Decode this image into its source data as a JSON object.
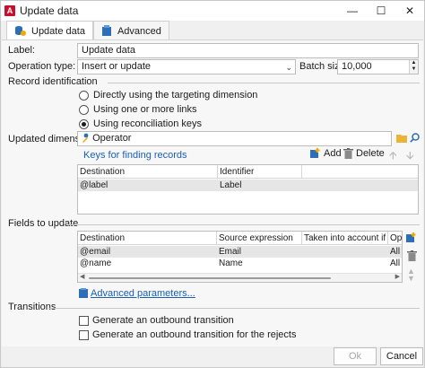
{
  "window": {
    "title": "Update data",
    "app_icon_letter": "A",
    "controls": [
      "—",
      "☐",
      "✕"
    ]
  },
  "tabs": [
    {
      "label": "Update data",
      "active": true
    },
    {
      "label": "Advanced",
      "active": false
    }
  ],
  "form": {
    "label_caption": "Label:",
    "label_value": "Update data",
    "operation_type_caption": "Operation type:",
    "operation_type_value": "Insert or update",
    "batch_size_caption": "Batch size:",
    "batch_size_value": "10,000"
  },
  "record_identification": {
    "title": "Record identification",
    "options": [
      {
        "label": "Directly using the targeting dimension",
        "checked": false
      },
      {
        "label": "Using one or more links",
        "checked": false
      },
      {
        "label": "Using reconciliation keys",
        "checked": true
      }
    ],
    "updated_dimension_caption": "Updated dimension:",
    "updated_dimension_value": "Operator",
    "keys_link": "Keys for finding records",
    "add_label": "Add",
    "delete_label": "Delete",
    "grid": {
      "columns": [
        "Destination",
        "Identifier"
      ],
      "rows": [
        {
          "destination": "@label",
          "identifier": "Label"
        }
      ]
    }
  },
  "fields_to_update": {
    "title": "Fields to update",
    "grid": {
      "columns": [
        "Destination",
        "Source expression",
        "Taken into account if",
        "Op"
      ],
      "rows": [
        {
          "destination": "@email",
          "source": "Email",
          "taken": "",
          "op": "All"
        },
        {
          "destination": "@name",
          "source": "Name",
          "taken": "",
          "op": "All"
        }
      ]
    },
    "advanced_link": "Advanced parameters..."
  },
  "transitions": {
    "title": "Transitions",
    "options": [
      {
        "label": "Generate an outbound transition",
        "checked": false
      },
      {
        "label": "Generate an outbound transition for the rejects",
        "checked": false
      }
    ]
  },
  "footer": {
    "ok_label": "Ok",
    "cancel_label": "Cancel"
  },
  "colors": {
    "app_icon": "#c8102e",
    "link": "#1a5fb4",
    "selected_row": "#e6e6e6"
  }
}
